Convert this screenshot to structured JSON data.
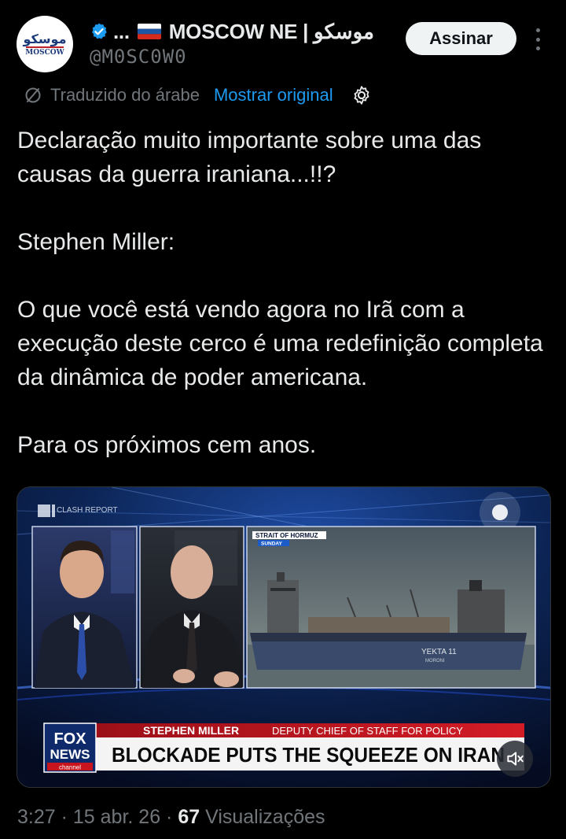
{
  "author": {
    "avatar_text_ar": "موسكو",
    "avatar_text_en": "MOSCOW",
    "name_prefix": "...",
    "name": "MOSCOW NE | موسكو",
    "handle": "@M0SC0W0",
    "verified_color": "#1d9bf0"
  },
  "actions": {
    "subscribe_label": "Assinar",
    "more_icon": "more-icon"
  },
  "translation": {
    "note": "Traduzido do árabe",
    "show_original": "Mostrar original"
  },
  "tweet": {
    "p1": "Declaração muito importante sobre uma das causas da guerra iraniana...!!?",
    "p2": "Stephen Miller:",
    "p3": "O que você está vendo agora no Irã com a execução deste cerco é uma redefinição completa da dinâmica de poder americana.",
    "p4": "Para os próximos cem anos."
  },
  "media": {
    "watermark": "CLASH REPORT",
    "location_tag": "STRAIT OF HORMUZ",
    "day_tag": "SUNDAY",
    "ship_name": "YEKTA 11",
    "ship_port": "MORONI",
    "lower_third_name": "STEPHEN MILLER",
    "lower_third_title": "DEPUTY CHIEF OF STAFF FOR POLICY",
    "headline": "BLOCKADE PUTS THE SQUEEZE ON IRAN",
    "network_line1": "FOX",
    "network_line2": "NEWS",
    "network_line3": "channel",
    "mute_icon": "speaker-muted-icon"
  },
  "footer": {
    "time": "3:27",
    "date": "15 abr. 26",
    "views_count": "67",
    "views_label": "Visualizações"
  }
}
